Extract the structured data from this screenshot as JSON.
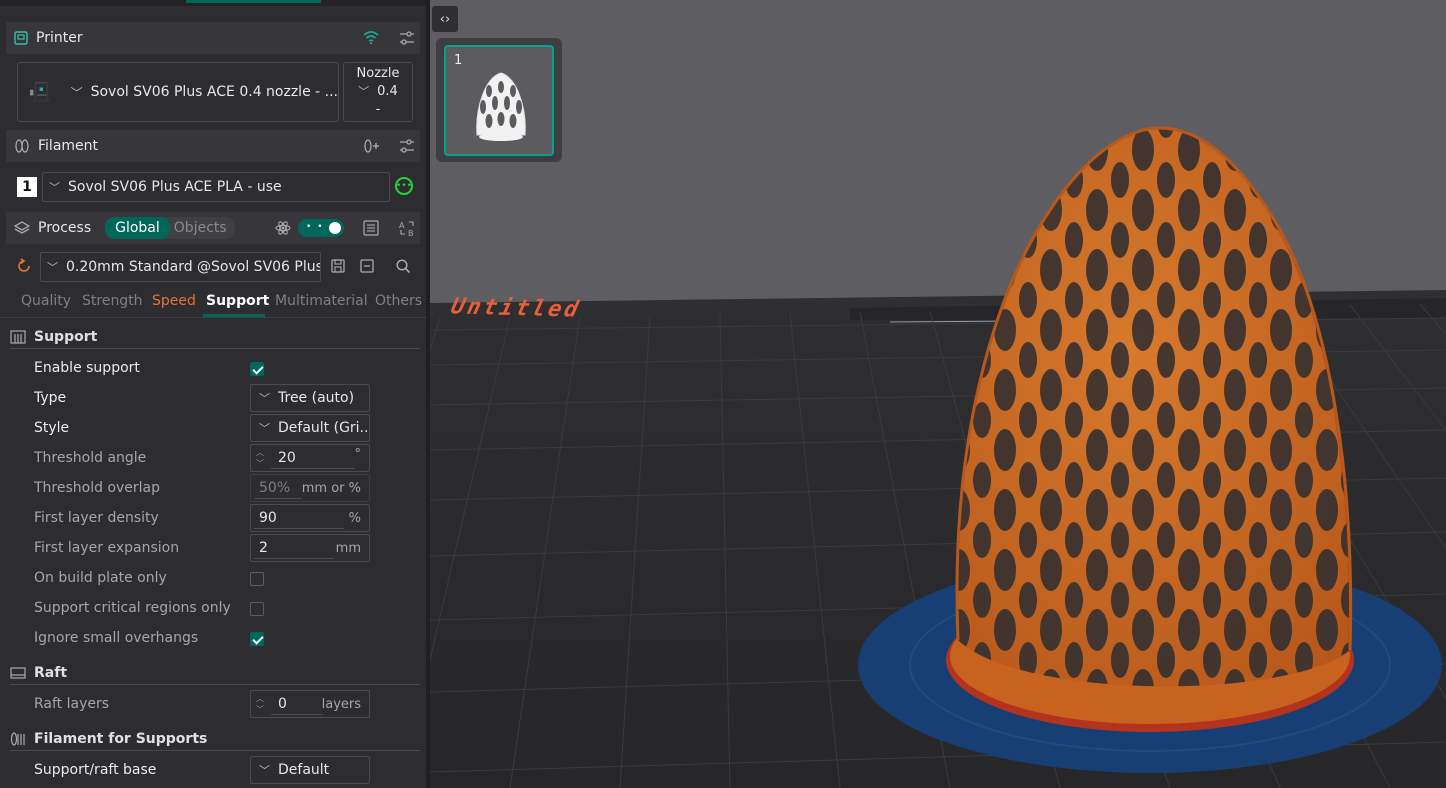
{
  "printer": {
    "section_title": "Printer",
    "name": "Sovol SV06 Plus ACE 0.4 nozzle - ...",
    "nozzle_label": "Nozzle",
    "nozzle_value": "0.4",
    "nozzle_extra": "-"
  },
  "filament": {
    "section_title": "Filament",
    "slot": "1",
    "name": "Sovol SV06 Plus ACE PLA - use"
  },
  "process": {
    "section_title": "Process",
    "mode_global": "Global",
    "mode_objects": "Objects",
    "preset": "0.20mm Standard @Sovol SV06 Plus..."
  },
  "tabs": [
    {
      "label": "Quality"
    },
    {
      "label": "Strength"
    },
    {
      "label": "Speed"
    },
    {
      "label": "Support"
    },
    {
      "label": "Multimaterial"
    },
    {
      "label": "Others"
    }
  ],
  "support": {
    "group_title": "Support",
    "enable_label": "Enable support",
    "enable_checked": true,
    "type_label": "Type",
    "type_value": "Tree (auto)",
    "style_label": "Style",
    "style_value": "Default (Gri...",
    "threshold_angle_label": "Threshold angle",
    "threshold_angle_value": "20",
    "threshold_angle_unit": "°",
    "threshold_overlap_label": "Threshold overlap",
    "threshold_overlap_value": "50%",
    "threshold_overlap_unit": "mm or %",
    "first_density_label": "First layer density",
    "first_density_value": "90",
    "first_density_unit": "%",
    "first_expansion_label": "First layer expansion",
    "first_expansion_value": "2",
    "first_expansion_unit": "mm",
    "build_plate_only_label": "On build plate only",
    "build_plate_only_checked": false,
    "critical_only_label": "Support critical regions only",
    "critical_only_checked": false,
    "ignore_small_label": "Ignore small overhangs",
    "ignore_small_checked": true
  },
  "raft": {
    "group_title": "Raft",
    "layers_label": "Raft layers",
    "layers_value": "0",
    "layers_unit": "layers"
  },
  "filament_supports": {
    "group_title": "Filament for Supports",
    "base_label": "Support/raft base",
    "base_value": "Default"
  },
  "viewport": {
    "plate_number": "1",
    "plate_name": "Untitled",
    "colors": {
      "model": "#c8621f",
      "brim": "#173f73",
      "bed": "#2b2b2e",
      "background": "#5e5e62",
      "accent": "#00675b"
    }
  }
}
